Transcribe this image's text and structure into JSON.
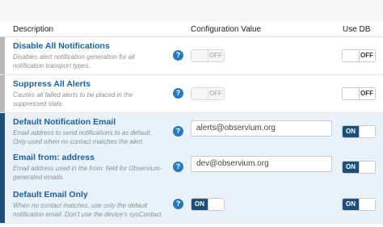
{
  "header": {
    "description": "Description",
    "config_value": "Configuration Value",
    "use_db": "Use DB"
  },
  "help_glyph": "?",
  "rows": [
    {
      "title": "Disable All Notifications",
      "description": "Disables alert notification generation for all notification transport types.",
      "config_toggle": "OFF",
      "use_db": "OFF"
    },
    {
      "title": "Suppress All Alerts",
      "description": "Causes all failed alerts to be placed in the suppressed state.",
      "config_toggle": "OFF",
      "use_db": "OFF"
    },
    {
      "title": "Default Notification Email",
      "description": "Email address to send notifications to as default. Only used when no contact matches the alert.",
      "config_value": "alerts@observium.org",
      "use_db": "ON"
    },
    {
      "title": "Email from: address",
      "description": "Email address used in the from: field for Observium-generated emails.",
      "config_value": "dev@observium.org",
      "use_db": "ON"
    },
    {
      "title": "Default Email Only",
      "description": "When no contact matches, use only the default notification email. Don't use the device's sysContact.",
      "config_toggle": "ON",
      "use_db": "ON"
    }
  ],
  "colors": {
    "title_blue": "#1b5f9e",
    "active_bar": "#1f4e79",
    "inactive_bar": "#b8b8b8",
    "active_row_bg": "#eaf1f8",
    "help_icon": "#2a7ab9"
  }
}
